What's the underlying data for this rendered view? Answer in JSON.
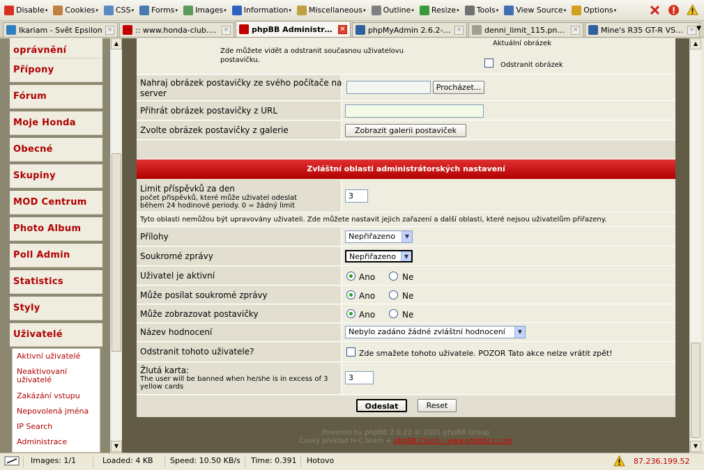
{
  "toolbar": {
    "items": [
      "Disable",
      "Cookies",
      "CSS",
      "Forms",
      "Images",
      "Information",
      "Miscellaneous",
      "Outline",
      "Resize",
      "Tools",
      "View Source",
      "Options"
    ]
  },
  "tabs": [
    {
      "label": "Ikariam - Svět Epsilon"
    },
    {
      "label": ":: www.honda-club.c..."
    },
    {
      "label": "phpBB Administra..."
    },
    {
      "label": "phpMyAdmin 2.6.2-D..."
    },
    {
      "label": "denni_limit_115.png ..."
    },
    {
      "label": "Mine's R35 GT-R VS S..."
    }
  ],
  "sidebar": {
    "items": [
      "oprávnění",
      "Přípony",
      "Fórum",
      "Moje Honda",
      "Obecné",
      "Skupiny",
      "MOD Centrum",
      "Photo Album",
      "Poll Admin",
      "Statistics",
      "Styly",
      "Uživatelé"
    ],
    "sub_items": [
      "Aktivní uživatelé",
      "Neaktivovaní uživatelé",
      "Zakázání vstupu",
      "Nepovolená jména",
      "IP Search",
      "Administrace"
    ]
  },
  "form": {
    "avatar_info": "Zde můžete vidět a odstranit současnou uživatelovu postavičku.",
    "current_avatar": "Aktuální obrázek",
    "remove_avatar": "Odstranit obrázek",
    "upload_label": "Nahraj obrázek postavičky ze svého počítače na server",
    "browse_button": "Procházet...",
    "url_label": "Přihrát obrázek postavičky z URL",
    "url_value": "",
    "gallery_label": "Zvolte obrázek postavičky z galerie",
    "gallery_button": "Zobrazit galerii postaviček",
    "admin_header": "Zvláštní oblasti administrátorských nastavení",
    "post_limit_label": "Limit příspěvků za den",
    "post_limit_desc": "počet příspěvků, které může uživatel odeslat během 24 hodinové periody. 0 = žádný limit",
    "post_limit_value": "3",
    "admin_note": "Tyto oblasti nemůžou být upravovány uživateli. Zde můžete nastavit jejich zařazení a další oblasti, které nejsou uživatelům přiřazeny.",
    "attachments_label": "Přílohy",
    "attachments_value": "Nepřiřazeno",
    "pm_label": "Soukromé zprávy",
    "pm_value": "Nepřiřazeno",
    "active_label": "Uživatel je aktivní",
    "can_pm_label": "Může posílat soukromé zprávy",
    "can_avatar_label": "Může zobrazovat postavičky",
    "yes": "Ano",
    "no": "Ne",
    "rank_label": "Název hodnocení",
    "rank_value": "Nebylo zadáno žádné zvláštní hodnocení",
    "delete_label": "Odstranit tohoto uživatele?",
    "delete_desc": "Zde smažete tohoto uživatele. POZOR Tato akce nelze vrátit zpět!",
    "yellow_label": "Žlutá karta:",
    "yellow_desc": "The user will be banned when he/she is in excess of 3 yellow cards",
    "yellow_value": "3",
    "submit": "Odeslat",
    "reset": "Reset"
  },
  "footer": {
    "powered": "Powered by phpBB 2.0.22 © 2001 phpBB Group",
    "translation_prefix": "Český překlad H-C team + ",
    "translation_link": "phpBB Czech - www.phpbbcz.com"
  },
  "status": {
    "images": "Images: 1/1",
    "loaded": "Loaded: 4 KB",
    "speed": "Speed: 10.50 KB/s",
    "time": "Time: 0.391",
    "state": "Hotovo",
    "ip": "87.236.199.52"
  }
}
